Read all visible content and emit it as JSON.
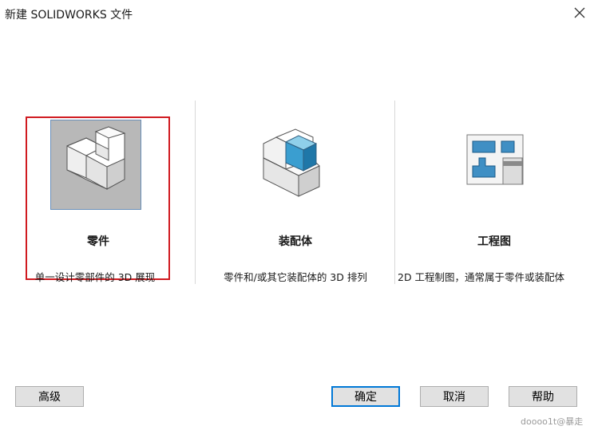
{
  "window": {
    "title": "新建 SOLIDWORKS 文件"
  },
  "options": [
    {
      "name": "零件",
      "description": "单一设计零部件的 3D 展现"
    },
    {
      "name": "装配体",
      "description": "零件和/或其它装配体的 3D 排列"
    },
    {
      "name": "工程图",
      "description": "2D 工程制图，通常属于零件或装配体"
    }
  ],
  "buttons": {
    "advanced": "高级",
    "ok": "确定",
    "cancel": "取消",
    "help": "帮助"
  },
  "watermark": "doooo1t@暴走",
  "colors": {
    "selection_border": "#d01a20",
    "default_button_border": "#0078d7",
    "selected_tile_bg": "#b8b8b8"
  },
  "icons": [
    "close-icon",
    "part-icon",
    "assembly-icon",
    "drawing-icon"
  ]
}
